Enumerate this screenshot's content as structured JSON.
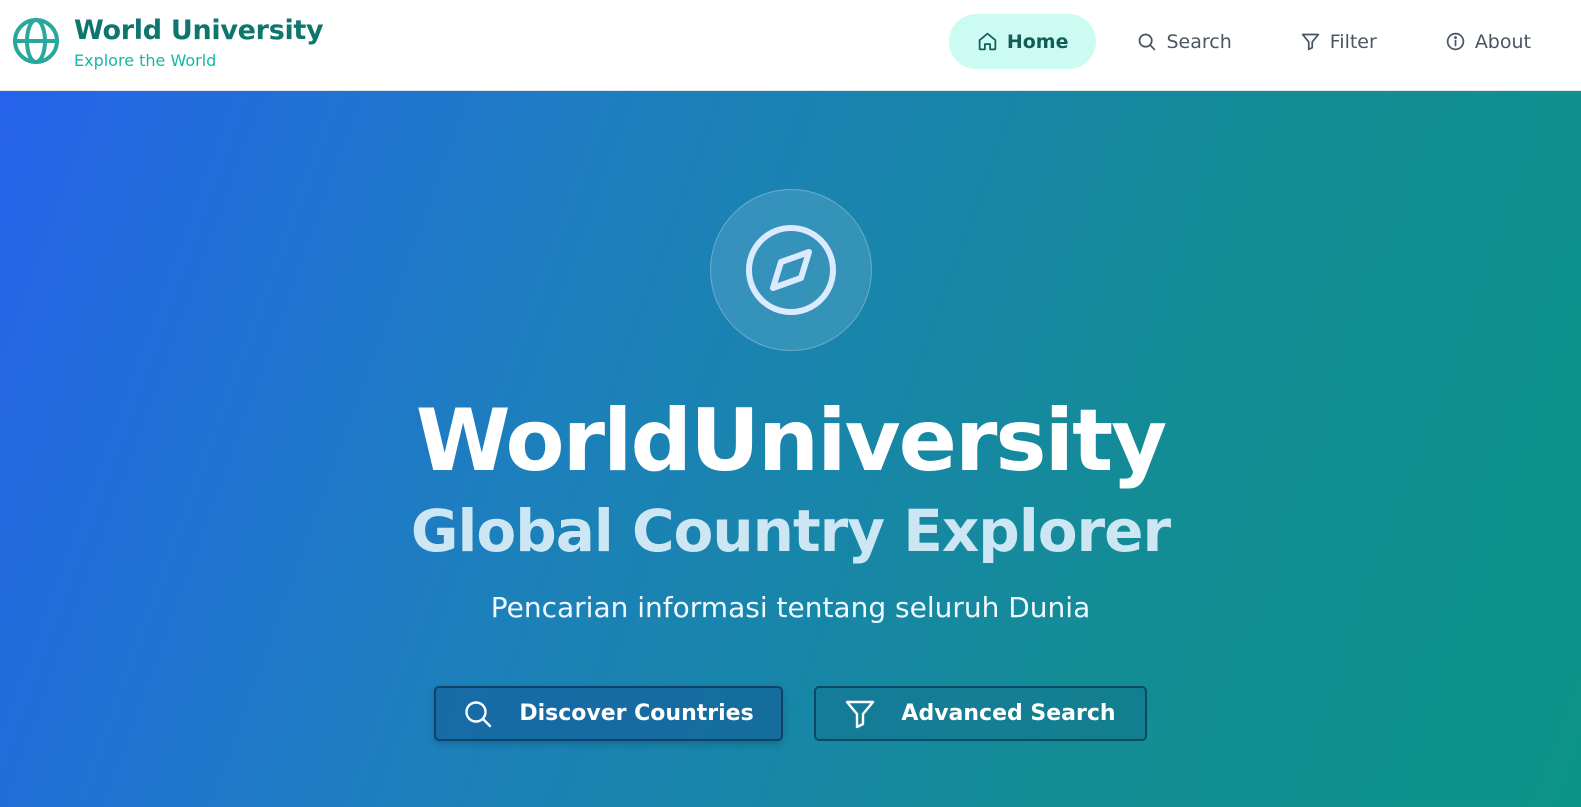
{
  "brand": {
    "title": "World University",
    "subtitle": "Explore the World",
    "icon": "globe-icon"
  },
  "nav": {
    "items": [
      {
        "label": "Home",
        "icon": "home-icon",
        "active": true
      },
      {
        "label": "Search",
        "icon": "search-icon",
        "active": false
      },
      {
        "label": "Filter",
        "icon": "filter-icon",
        "active": false
      },
      {
        "label": "About",
        "icon": "info-icon",
        "active": false
      }
    ]
  },
  "hero": {
    "icon": "compass-icon",
    "title": "WorldUniversity",
    "subtitle": "Global Country Explorer",
    "description": "Pencarian informasi tentang seluruh Dunia",
    "buttons": {
      "discover": {
        "label": "Discover Countries",
        "icon": "search-icon"
      },
      "advanced": {
        "label": "Advanced Search",
        "icon": "filter-icon"
      }
    }
  },
  "colors": {
    "brand_primary": "#0f766e",
    "brand_accent": "#14b8a6",
    "active_nav_bg": "#ccfbf1",
    "hero_gradient_start": "#2563eb",
    "hero_gradient_end": "#0d9488"
  }
}
